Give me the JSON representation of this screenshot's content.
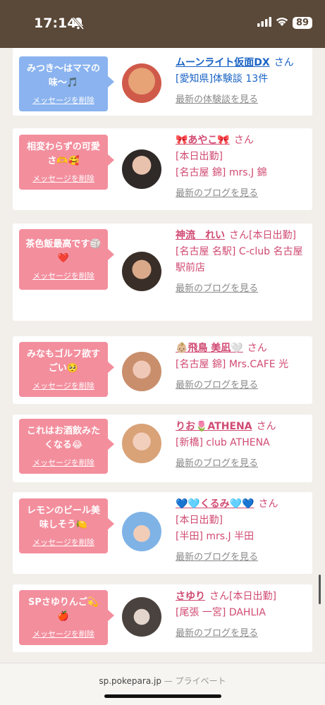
{
  "status": {
    "time": "17:14",
    "battery": "89"
  },
  "items": [
    {
      "message": "みつき〜はママの味〜🎵",
      "delete_label": "メッセージを削除",
      "name": "ムーンライト仮面DX",
      "suffix": "さん",
      "lines": [
        "[愛知県]体験談 13件"
      ],
      "link": "最新の体験談を見る",
      "theme": "blue"
    },
    {
      "message": "相変わらずの可愛さ🫶🥰",
      "delete_label": "メッセージを削除",
      "name": "🎀あやこ🎀",
      "suffix": "さん",
      "lines": [
        "[本日出勤]",
        "[名古屋 錦] mrs.J 錦"
      ],
      "link": "最新のブログを見る",
      "theme": "pink"
    },
    {
      "message": "茶色飯最高です🏐❤️",
      "delete_label": "メッセージを削除",
      "name": "神流　れい",
      "suffix": "さん[本日出勤]",
      "lines": [
        "[名古屋 名駅] C-club 名古屋駅前店"
      ],
      "link": "最新のブログを見る",
      "theme": "pink"
    },
    {
      "message": "みなもゴルフ欲すごい🥺",
      "delete_label": "メッセージを削除",
      "name": "👶🏼飛鳥 美凪🤍",
      "suffix": "さん",
      "lines": [
        "[名古屋 錦] Mrs.CAFE 光"
      ],
      "link": "最新のブログを見る",
      "theme": "pink"
    },
    {
      "message": "これはお酒飲みたくなる😂",
      "delete_label": "メッセージを削除",
      "name": "りお🌷ATHENA",
      "suffix": "さん",
      "lines": [
        "[新橋] club ATHENA"
      ],
      "link": "最新のブログを見る",
      "theme": "pink"
    },
    {
      "message": "レモンのビール美味しそう🍋",
      "delete_label": "メッセージを削除",
      "name": "💙🩵くるみ🩵💙",
      "suffix": "さん",
      "lines": [
        "[本日出勤]",
        "[半田] mrs.J 半田"
      ],
      "link": "最新のブログを見る",
      "theme": "pink"
    },
    {
      "message": "SPさゆりんご💫🍎",
      "delete_label": "メッセージを削除",
      "name": "さゆり",
      "suffix": "さん[本日出勤]",
      "lines": [
        "[尾張 一宮] DAHLIA"
      ],
      "link": "最新のブログを見る",
      "theme": "pink"
    }
  ],
  "browser": {
    "domain": "sp.pokepara.jp",
    "separator": "—",
    "mode": "プライベート"
  },
  "colors": {
    "status_bg": "#5a4838",
    "bubble_blue": "#8ab3ef",
    "bubble_pink": "#f38e9d",
    "name_pink": "#d04a72",
    "name_blue": "#1a63c4"
  }
}
